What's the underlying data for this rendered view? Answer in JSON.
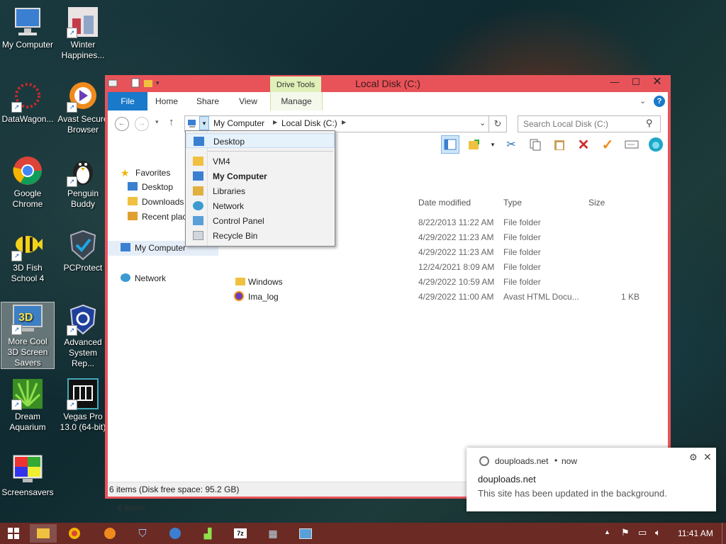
{
  "desktop": {
    "icons": [
      {
        "label": "My Computer"
      },
      {
        "label": "Winter Happines..."
      },
      {
        "label": "DataWagon..."
      },
      {
        "label": "Avast Secure Browser"
      },
      {
        "label": "Google Chrome"
      },
      {
        "label": "Penguin Buddy"
      },
      {
        "label": "3D Fish School 4"
      },
      {
        "label": "PCProtect"
      },
      {
        "label": "More Cool 3D Screen Savers"
      },
      {
        "label": "Advanced System Rep..."
      },
      {
        "label": "Dream Aquarium"
      },
      {
        "label": "Vegas Pro 13.0 (64-bit)"
      },
      {
        "label": "Screensavers"
      }
    ]
  },
  "window": {
    "title": "Local Disk (C:)",
    "context_tab": "Drive Tools",
    "tabs": [
      "File",
      "Home",
      "Share",
      "View",
      "Manage"
    ],
    "address": {
      "segments": [
        "My Computer",
        "Local Disk (C:)"
      ]
    },
    "search_placeholder": "Search Local Disk (C:)",
    "nav": {
      "favorites": "Favorites",
      "favorites_items": [
        "Desktop",
        "Downloads",
        "Recent plac"
      ],
      "my_computer": "My Computer",
      "network": "Network"
    },
    "columns": {
      "date": "Date modified",
      "type": "Type",
      "size": "Size"
    },
    "files": [
      {
        "name": "",
        "date": "8/22/2013 11:22 AM",
        "type": "File folder",
        "size": ""
      },
      {
        "name": "",
        "date": "4/29/2022 11:23 AM",
        "type": "File folder",
        "size": ""
      },
      {
        "name": "",
        "date": "4/29/2022 11:23 AM",
        "type": "File folder",
        "size": ""
      },
      {
        "name": "",
        "date": "12/24/2021 8:09 AM",
        "type": "File folder",
        "size": ""
      },
      {
        "name": "Windows",
        "date": "4/29/2022 10:59 AM",
        "type": "File folder",
        "size": ""
      },
      {
        "name": "Ima_log",
        "date": "4/29/2022 11:00 AM",
        "type": "Avast HTML Docu...",
        "size": "1 KB"
      }
    ],
    "item_count": "6 items",
    "status": "6 items (Disk free space: 95.2 GB)"
  },
  "dropdown": {
    "items": [
      {
        "label": "Desktop",
        "bold": false
      },
      {
        "label": "VM4",
        "bold": false
      },
      {
        "label": "My Computer",
        "bold": true
      },
      {
        "label": "Libraries",
        "bold": false
      },
      {
        "label": "Network",
        "bold": false
      },
      {
        "label": "Control Panel",
        "bold": false
      },
      {
        "label": "Recycle Bin",
        "bold": false
      }
    ]
  },
  "toast": {
    "site": "douploads.net",
    "time": "now",
    "title": "douploads.net",
    "message": "This site has been updated in the background."
  },
  "taskbar": {
    "clock": "11:41 AM"
  },
  "colors": {
    "window_frame": "#e8535a",
    "taskbar": "#6b2a24",
    "accent": "#1979ca"
  }
}
